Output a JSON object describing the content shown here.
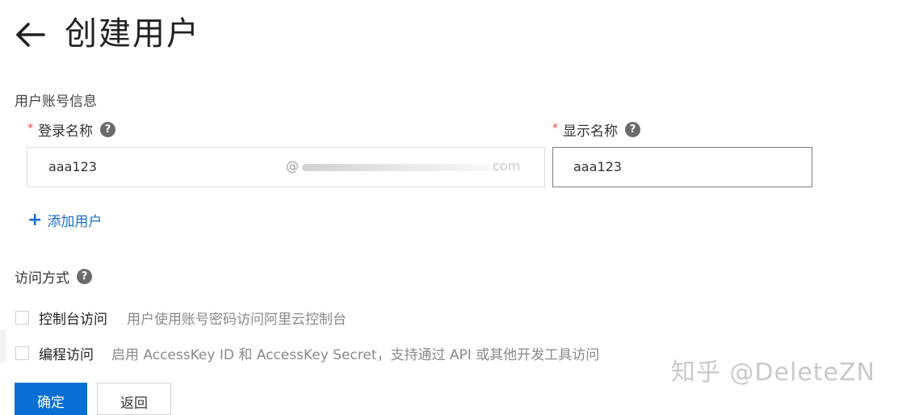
{
  "header": {
    "title": "创建用户",
    "back_icon": "arrow-left-icon"
  },
  "account_section": {
    "title": "用户账号信息",
    "login_name": {
      "label": "登录名称",
      "value": "aaa123",
      "domain_prefix": "@",
      "domain_suffix": "com"
    },
    "display_name": {
      "label": "显示名称",
      "value": "aaa123"
    },
    "help_icon": "?",
    "required_mark": "*",
    "add_user": "添加用户"
  },
  "access_section": {
    "title": "访问方式",
    "options": [
      {
        "label": "控制台访问",
        "desc": "用户使用账号密码访问阿里云控制台",
        "checked": false
      },
      {
        "label": "编程访问",
        "desc": "启用 AccessKey ID 和 AccessKey Secret，支持通过 API 或其他开发工具访问",
        "checked": false
      }
    ]
  },
  "actions": {
    "confirm": "确定",
    "back": "返回"
  },
  "watermark": "知乎 @DeleteZN",
  "colors": {
    "primary": "#0a6fd3",
    "link": "#1a6fd0",
    "required": "#e8453c"
  }
}
